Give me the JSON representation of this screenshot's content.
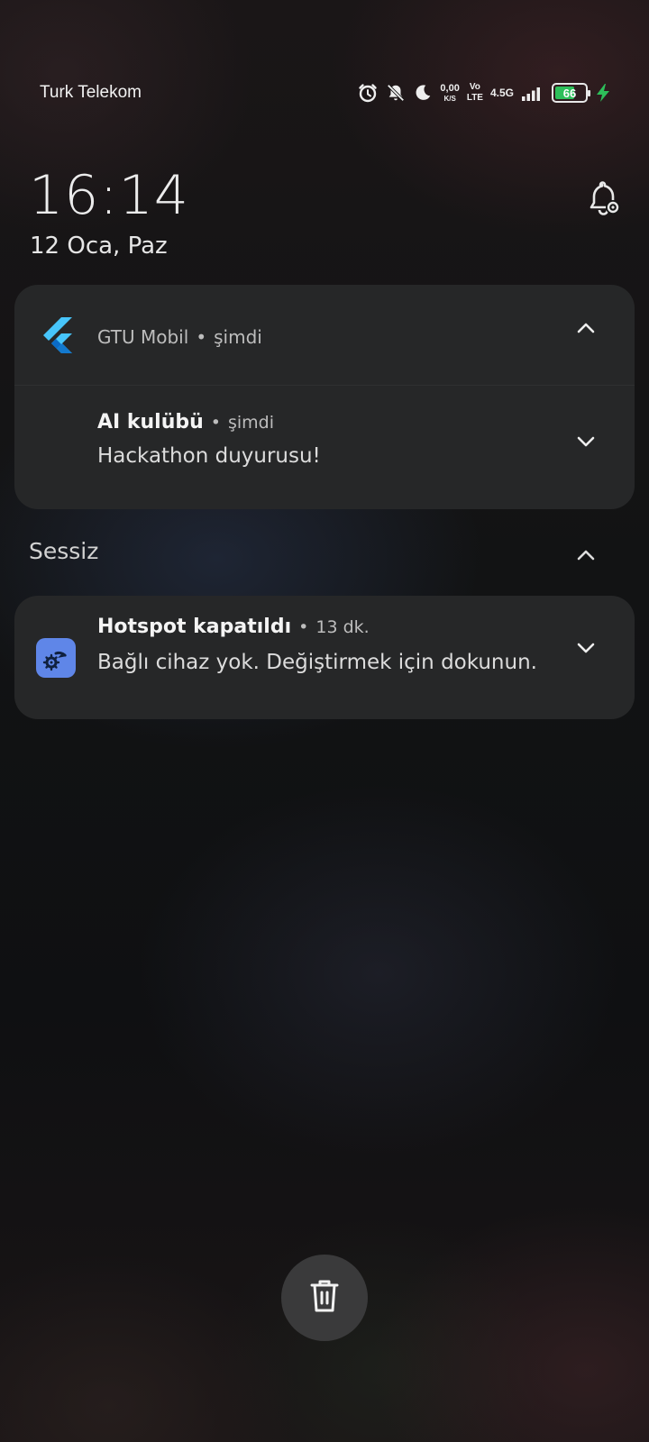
{
  "status_bar": {
    "carrier": "Turk Telekom",
    "net_speed_value": "0,00",
    "net_speed_unit": "K/S",
    "volte_top": "Vo",
    "volte_bottom": "LTE",
    "network_gen": "4.5G",
    "battery_level": "66",
    "battery_percent": 66,
    "battery_color": "#2dbf5a",
    "icons": [
      "alarm-icon",
      "bell-muted-icon",
      "moon-icon",
      "signal-icon",
      "charging-bolt-icon"
    ]
  },
  "lockscreen": {
    "time": "16:14",
    "date": "12 Oca, Paz"
  },
  "notification_group": {
    "app_name": "GTU Mobil",
    "time": "şimdi",
    "messages": [
      {
        "title": "AI kulübü",
        "time": "şimdi",
        "body": "Hackathon duyurusu!"
      }
    ]
  },
  "silent_section": {
    "label": "Sessiz",
    "notifications": [
      {
        "title": "Hotspot kapatıldı",
        "time": "13 dk.",
        "body": "Bağlı cihaz yok. Değiştirmek için dokunun."
      }
    ]
  },
  "colors": {
    "card_bg": "#262728",
    "hotspot_icon_bg": "#5f86e8",
    "flutter_light": "#47c5fb",
    "flutter_dark": "#0a6bc6"
  }
}
